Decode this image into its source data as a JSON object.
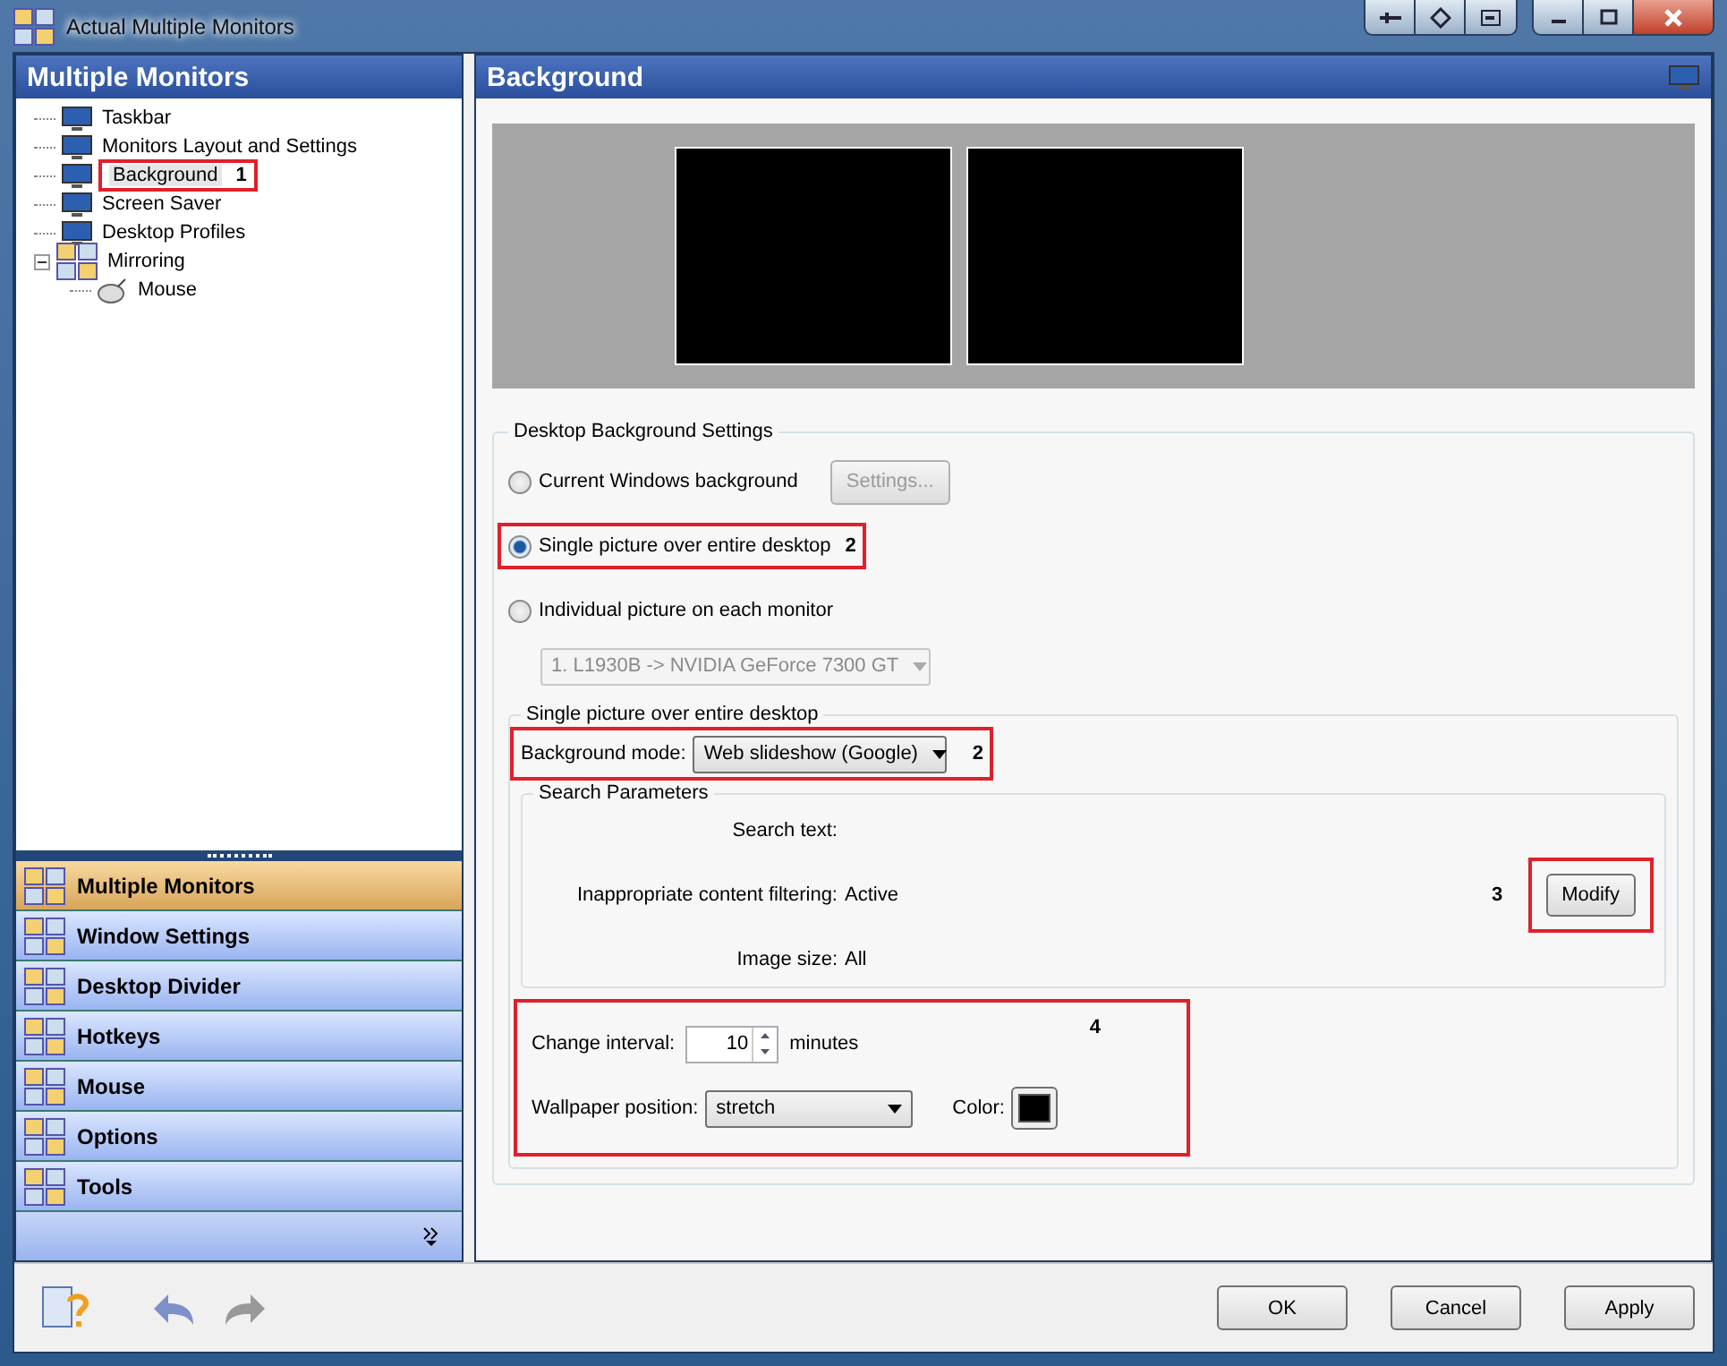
{
  "window": {
    "title": "Actual Multiple Monitors"
  },
  "left_panel": {
    "title": "Multiple Monitors",
    "tree": [
      {
        "label": "Taskbar",
        "selected": false
      },
      {
        "label": "Monitors Layout and Settings",
        "selected": false
      },
      {
        "label": "Background",
        "selected": true,
        "callout": "1"
      },
      {
        "label": "Screen Saver",
        "selected": false
      },
      {
        "label": "Desktop Profiles",
        "selected": false
      },
      {
        "label": "Mirroring",
        "selected": false,
        "expanded": true,
        "children": [
          {
            "label": "Mouse",
            "selected": false
          }
        ]
      }
    ]
  },
  "nav_bar": {
    "items": [
      {
        "label": "Multiple Monitors",
        "selected": true
      },
      {
        "label": "Window Settings",
        "selected": false
      },
      {
        "label": "Desktop Divider",
        "selected": false
      },
      {
        "label": "Hotkeys",
        "selected": false
      },
      {
        "label": "Mouse",
        "selected": false
      },
      {
        "label": "Options",
        "selected": false
      },
      {
        "label": "Tools",
        "selected": false
      }
    ]
  },
  "content": {
    "title": "Background",
    "desktop_settings": {
      "legend": "Desktop Background Settings",
      "options": [
        {
          "label": "Current Windows background",
          "selected": false
        },
        {
          "label": "Single picture over entire desktop",
          "selected": true,
          "callout": "2"
        },
        {
          "label": "Individual picture on each monitor",
          "selected": false
        }
      ],
      "settings_button": {
        "label": "Settings...",
        "disabled": true
      },
      "monitor_select": {
        "value": "1. L1930B -> NVIDIA GeForce 7300 GT",
        "disabled": true
      }
    },
    "single_picture": {
      "legend": "Single picture over entire desktop",
      "background_mode": {
        "label": "Background mode:",
        "value": "Web slideshow (Google)",
        "callout": "2"
      },
      "search": {
        "legend": "Search Parameters",
        "rows": [
          {
            "label": "Search text:"
          },
          {
            "label": "Inappropriate content filtering:",
            "value": "Active"
          },
          {
            "label": "Image size:",
            "value": "All"
          }
        ],
        "modify_button": "Modify",
        "callout": "3"
      },
      "slideshow": {
        "callout": "4",
        "change_interval": {
          "label": "Change interval:",
          "value": "10",
          "unit": "minutes"
        },
        "wallpaper_position": {
          "label": "Wallpaper position:",
          "value": "stretch"
        },
        "color": {
          "label": "Color:",
          "color": "#000000"
        }
      }
    }
  },
  "buttons": [
    "OK",
    "Cancel",
    "Apply"
  ]
}
